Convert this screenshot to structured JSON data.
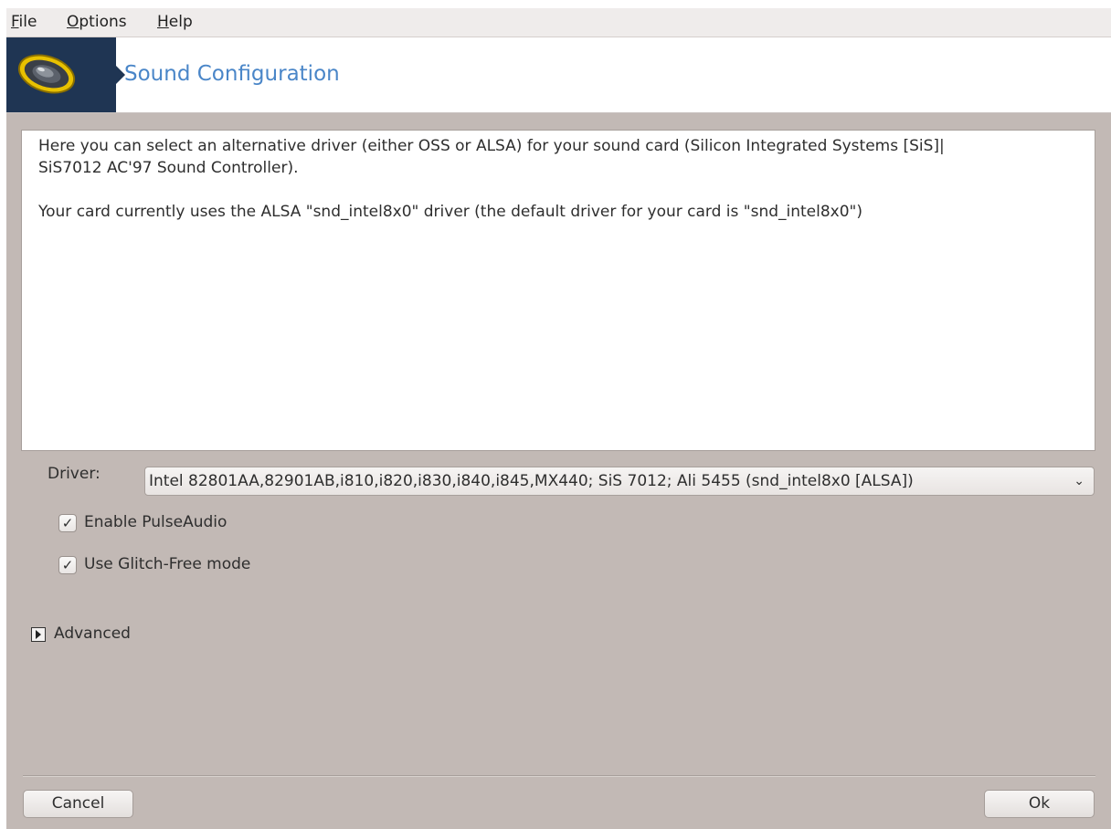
{
  "menubar": {
    "file_pre": "",
    "file_mn": "F",
    "file_post": "ile",
    "options_pre": "",
    "options_mn": "O",
    "options_post": "ptions",
    "help_pre": "",
    "help_mn": "H",
    "help_post": "elp"
  },
  "banner": {
    "title": "Sound Configuration",
    "icon": "speaker-icon"
  },
  "info": {
    "line1": "Here you can select an alternative driver (either OSS or ALSA) for your sound card (Silicon Integrated Systems [SiS]|",
    "line2": "SiS7012 AC'97 Sound Controller).",
    "line3": "Your card currently uses the ALSA \"snd_intel8x0\" driver (the default driver for your card is \"snd_intel8x0\")"
  },
  "driver": {
    "label": "Driver:",
    "selected": "Intel 82801AA,82901AB,i810,i820,i830,i840,i845,MX440; SiS 7012; Ali 5455 (snd_intel8x0 [ALSA])",
    "chevron": "⌄"
  },
  "options": {
    "pulseaudio_label": "Enable PulseAudio",
    "pulseaudio_checked": true,
    "glitchfree_label": "Use Glitch-Free mode",
    "glitchfree_checked": true
  },
  "advanced": {
    "label": "Advanced",
    "expanded": false
  },
  "buttons": {
    "cancel": "Cancel",
    "ok": "Ok"
  },
  "colors": {
    "window_bg": "#c2b9b5",
    "banner_icon_bg": "#1f3553",
    "title_color": "#4a86c8"
  }
}
